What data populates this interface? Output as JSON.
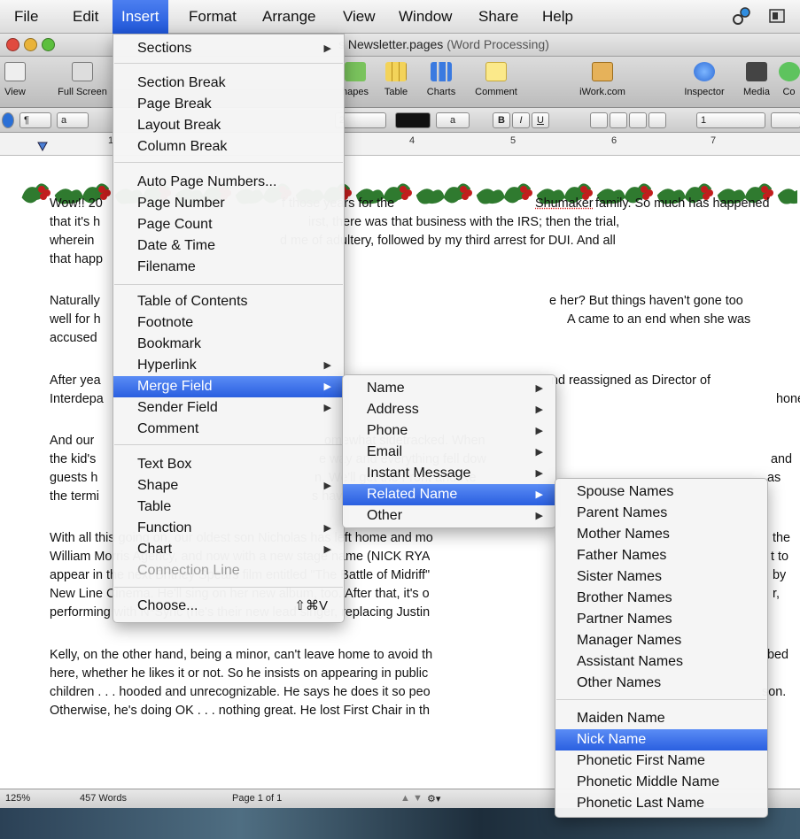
{
  "menubar": {
    "items": [
      "File",
      "Edit",
      "Insert",
      "Format",
      "Arrange",
      "View",
      "Window",
      "Share",
      "Help"
    ],
    "active": "Insert"
  },
  "window": {
    "title": "s Newsletter.pages",
    "subtitle": "(Word Processing)"
  },
  "toolbar": {
    "buttons": [
      "View",
      "Full Screen",
      "hapes",
      "Table",
      "Charts",
      "Comment",
      "iWork.com",
      "Inspector",
      "Media",
      "Co"
    ]
  },
  "formatbar": {
    "para_style": "¶",
    "char_style": "a",
    "font_size": "2",
    "text_color_label": "a",
    "bold": "B",
    "italic": "I",
    "underline": "U",
    "line_spacing": "1"
  },
  "ruler": {
    "numbers": [
      "1",
      "4",
      "5",
      "6",
      "7"
    ]
  },
  "document": {
    "paragraphs": [
      [
        "Wow!! 20",
        "f those years for the ",
        "Shumaker",
        " family. So much has happened"
      ],
      [
        "that it's h",
        "irst, there was that business with the IRS; then the trial,"
      ],
      [
        "wherein",
        "d me of adultery, followed by my third arrest for DUI. And all"
      ],
      [
        "that happ"
      ],
      [
        "Naturally",
        "e her? But things haven't gone too"
      ],
      [
        "well for h",
        "A came to an end when she was"
      ],
      [
        "accused"
      ],
      [
        "After yea",
        "nd reassigned as Director of"
      ],
      [
        "Interdepa",
        "hone"
      ],
      [
        "And our",
        "omewhat sidetracked. When",
        "nto"
      ],
      [
        "the kid's",
        "e way and everything fell dow",
        "and"
      ],
      [
        "guests h",
        "n. We'll get the Front and Re",
        "as"
      ],
      [
        "the termi",
        "s have been cleared up!"
      ],
      [
        "With all this going on, our oldest son Nicholas has left home and mo",
        "the"
      ],
      [
        "William Morris Agency, and now with a new stage name (NICK RYA",
        "t to"
      ],
      [
        "appear in the next Britney Spears film entitled \"The Battle of Midriff\"",
        "by"
      ],
      [
        "New Line Cinema. He'll sing on her new album, too. After that, it's o",
        "r,"
      ],
      [
        "performing with N*Sync (he's their new lead singer, replacing Justin"
      ],
      [
        "Kelly, on the other hand, being a minor, can't leave home to avoid th",
        "bed"
      ],
      [
        "here, whether he likes it or not. So he insists on appearing in public"
      ],
      [
        "children . . . hooded and unrecognizable. He says he does it so peo",
        "son."
      ],
      [
        "Otherwise, he's doing OK . . . nothing great. He lost First Chair in th"
      ]
    ]
  },
  "statusbar": {
    "zoom": "125%",
    "words": "457 Words",
    "page": "Page 1 of 1"
  },
  "insert_menu": {
    "items": [
      {
        "label": "Sections",
        "submenu": true
      },
      {
        "label": "Section Break"
      },
      {
        "label": "Page Break"
      },
      {
        "label": "Layout Break"
      },
      {
        "label": "Column Break"
      },
      {
        "label": "Auto Page Numbers..."
      },
      {
        "label": "Page Number"
      },
      {
        "label": "Page Count"
      },
      {
        "label": "Date & Time"
      },
      {
        "label": "Filename"
      },
      {
        "label": "Table of Contents"
      },
      {
        "label": "Footnote"
      },
      {
        "label": "Bookmark"
      },
      {
        "label": "Hyperlink",
        "submenu": true
      },
      {
        "label": "Merge Field",
        "submenu": true,
        "highlighted": true
      },
      {
        "label": "Sender Field",
        "submenu": true
      },
      {
        "label": "Comment"
      },
      {
        "label": "Text Box"
      },
      {
        "label": "Shape",
        "submenu": true
      },
      {
        "label": "Table"
      },
      {
        "label": "Function",
        "submenu": true
      },
      {
        "label": "Chart",
        "submenu": true
      },
      {
        "label": "Connection Line",
        "disabled": true
      },
      {
        "label": "Choose...",
        "shortcut": "⇧⌘V"
      }
    ]
  },
  "merge_menu": {
    "items": [
      {
        "label": "Name",
        "submenu": true
      },
      {
        "label": "Address",
        "submenu": true
      },
      {
        "label": "Phone",
        "submenu": true
      },
      {
        "label": "Email",
        "submenu": true
      },
      {
        "label": "Instant Message",
        "submenu": true
      },
      {
        "label": "Related Name",
        "submenu": true,
        "highlighted": true
      },
      {
        "label": "Other",
        "submenu": true
      }
    ]
  },
  "related_menu": {
    "items": [
      {
        "label": "Spouse Names"
      },
      {
        "label": "Parent Names"
      },
      {
        "label": "Mother Names"
      },
      {
        "label": "Father Names"
      },
      {
        "label": "Sister Names"
      },
      {
        "label": "Brother Names"
      },
      {
        "label": "Partner Names"
      },
      {
        "label": "Manager Names"
      },
      {
        "label": "Assistant Names"
      },
      {
        "label": "Other Names"
      },
      {
        "label": "Maiden Name"
      },
      {
        "label": "Nick Name",
        "highlighted": true
      },
      {
        "label": "Phonetic First Name"
      },
      {
        "label": "Phonetic Middle Name"
      },
      {
        "label": "Phonetic Last Name"
      }
    ]
  },
  "colors": {
    "highlight": "#2a5fe0",
    "holly_green": "#2f7a2f",
    "berry_red": "#c21d1d"
  }
}
